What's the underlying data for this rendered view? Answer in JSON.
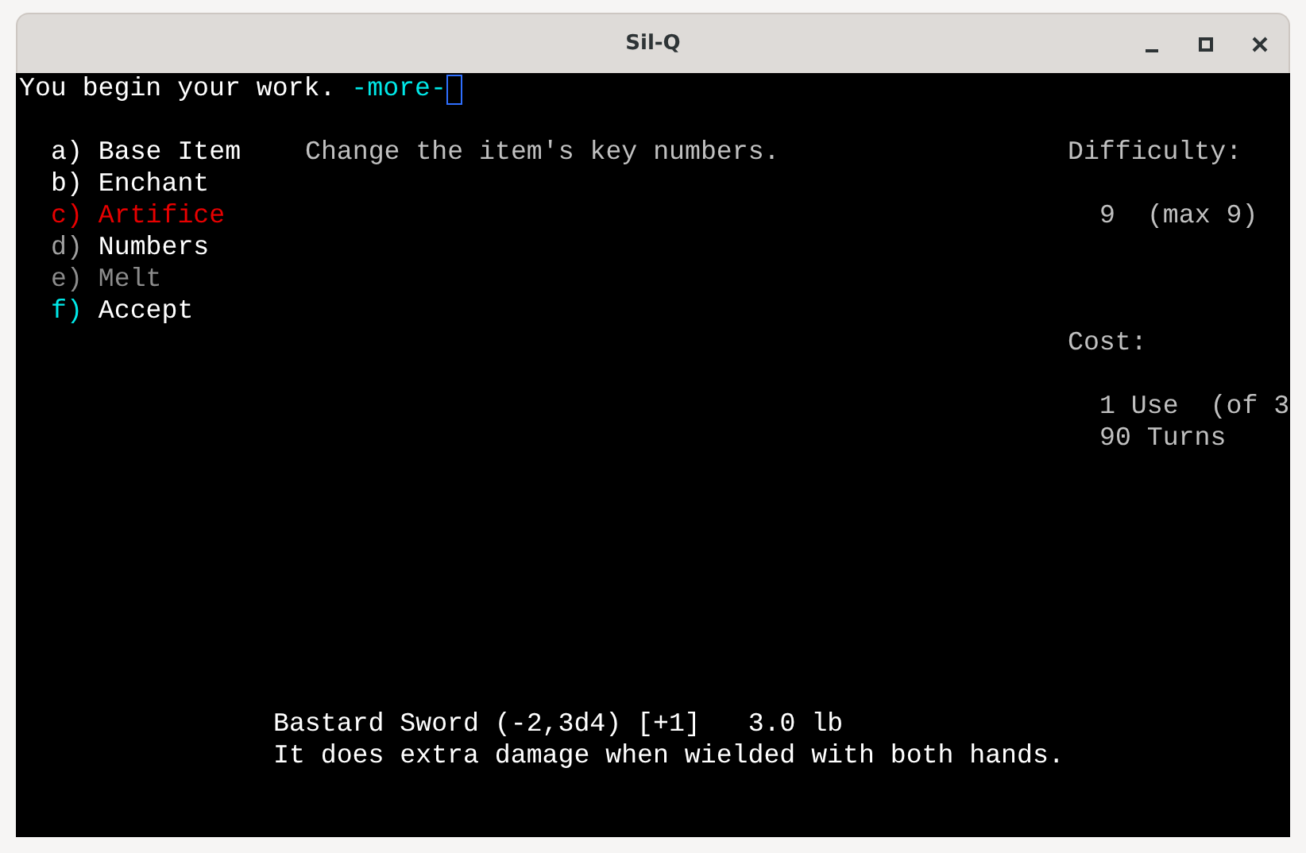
{
  "window": {
    "title": "Sil-Q"
  },
  "message": {
    "text": "You begin your work.",
    "more": "-more-"
  },
  "menu": [
    {
      "key": {
        "text": "a)",
        "color": "#ffffff"
      },
      "label": "Base Item",
      "color": "#ffffff"
    },
    {
      "key": {
        "text": "b)",
        "color": "#ffffff"
      },
      "label": "Enchant",
      "color": "#ffffff"
    },
    {
      "key": {
        "text": "c)",
        "color": "#e80000"
      },
      "label": "Artifice",
      "color": "#e80000"
    },
    {
      "key": {
        "text": "d)",
        "color": "#a0a0a0"
      },
      "label": "Numbers",
      "color": "#ffffff"
    },
    {
      "key": {
        "text": "e)",
        "color": "#8c8c8c"
      },
      "label": "Melt",
      "color": "#8c8c8c"
    },
    {
      "key": {
        "text": "f)",
        "color": "#00e8e8"
      },
      "label": "Accept",
      "color": "#ffffff"
    }
  ],
  "description": "Change the item's key numbers.",
  "difficulty": {
    "label": "Difficulty:",
    "value": "9",
    "max": "(max 9)"
  },
  "cost": {
    "label": "Cost:",
    "uses": "1 Use",
    "uses_of": "(of 3",
    "turns": "90 Turns"
  },
  "item": {
    "name": "Bastard Sword (-2,3d4) [+1]",
    "weight": "3.0 lb",
    "note": "It does extra damage when wielded with both hands."
  }
}
